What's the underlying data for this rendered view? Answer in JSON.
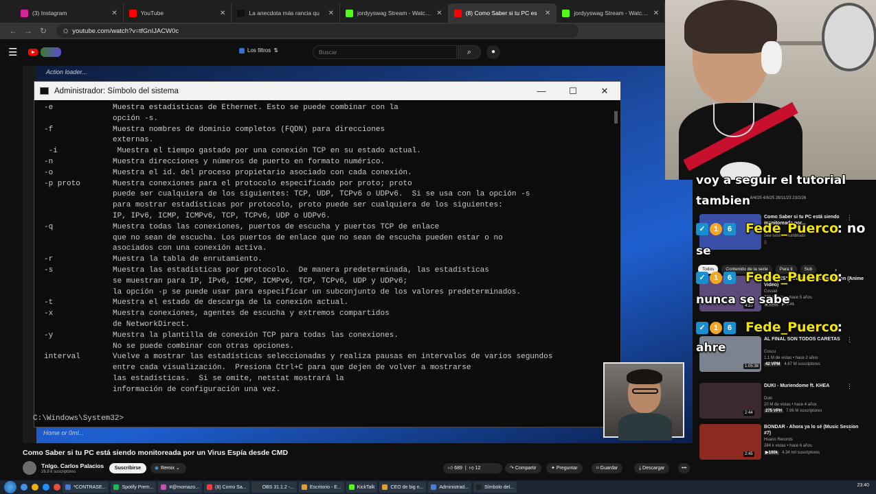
{
  "browser": {
    "tabs": [
      {
        "label": "(3) Instagram",
        "color": "#d6249f"
      },
      {
        "label": "YouTube",
        "color": "#ff0000"
      },
      {
        "label": "La anecdota más rancia qu",
        "color": "#111111"
      },
      {
        "label": "jordyyswag Stream - Watch Liv",
        "color": "#53fc18"
      },
      {
        "label": "(8) Como Saber si tu PC es",
        "color": "#ff0000",
        "active": true
      },
      {
        "label": "jordyyswag Stream - Watch Liv",
        "color": "#53fc18"
      }
    ],
    "url": "youtube.com/watch?v=tfGnIJACW0c"
  },
  "youtube": {
    "filters_label": "Los filtros",
    "search_placeholder": "Buscar"
  },
  "video": {
    "overlay_top": "Action loader...",
    "overlay_bottom": "Home or 0ml...",
    "cmd_title": "Administrador: Símbolo del sistema",
    "cmd_lines": [
      {
        "flag": "-e",
        "desc": "Muestra estadísticas de Ethernet. Esto se puede combinar con la"
      },
      {
        "flag": "",
        "desc": "opción -s."
      },
      {
        "flag": "-f",
        "desc": "Muestra nombres de dominio completos (FQDN) para direcciones"
      },
      {
        "flag": "",
        "desc": "externas."
      },
      {
        "flag": " -i",
        "desc": " Muestra el tiempo gastado por una conexión TCP en su estado actual."
      },
      {
        "flag": "-n",
        "desc": "Muestra direcciones y números de puerto en formato numérico."
      },
      {
        "flag": "-o",
        "desc": "Muestra el id. del proceso propietario asociado con cada conexión."
      },
      {
        "flag": "-p proto",
        "desc": "Muestra conexiones para el protocolo especificado por proto; proto"
      },
      {
        "flag": "",
        "desc": "puede ser cualquiera de los siguientes: TCP, UDP, TCPv6 o UDPv6.  Si se usa con la opción -s"
      },
      {
        "flag": "",
        "desc": "para mostrar estadísticas por protocolo, proto puede ser cualquiera de los siguientes:"
      },
      {
        "flag": "",
        "desc": "IP, IPv6, ICMP, ICMPv6, TCP, TCPv6, UDP o UDPv6."
      },
      {
        "flag": "-q",
        "desc": "Muestra todas las conexiones, puertos de escucha y puertos TCP de enlace"
      },
      {
        "flag": "",
        "desc": "que no sean de escucha. Los puertos de enlace que no sean de escucha pueden estar o no"
      },
      {
        "flag": "",
        "desc": "asociados con una conexión activa."
      },
      {
        "flag": "-r",
        "desc": "Muestra la tabla de enrutamiento."
      },
      {
        "flag": "-s",
        "desc": "Muestra las estadísticas por protocolo.  De manera predeterminada, las estadísticas"
      },
      {
        "flag": "",
        "desc": "se muestran para IP, IPv6, ICMP, ICMPv6, TCP, TCPv6, UDP y UDPv6;"
      },
      {
        "flag": "",
        "desc": "la opción -p se puede usar para especificar un subconjunto de los valores predeterminados."
      },
      {
        "flag": "-t",
        "desc": "Muestra el estado de descarga de la conexión actual."
      },
      {
        "flag": "-x",
        "desc": "Muestra conexiones, agentes de escucha y extremos compartidos"
      },
      {
        "flag": "",
        "desc": "de NetworkDirect."
      },
      {
        "flag": "-y",
        "desc": "Muestra la plantilla de conexión TCP para todas las conexiones."
      },
      {
        "flag": "",
        "desc": "No se puede combinar con otras opciones."
      },
      {
        "flag": "interval",
        "desc": "Vuelve a mostrar las estadísticas seleccionadas y realiza pausas en intervalos de varios segundos"
      },
      {
        "flag": "",
        "desc": "entre cada visualización.  Presiona Ctrl+C para que dejen de volver a mostrarse"
      },
      {
        "flag": "",
        "desc": "las estadísticas.  Si se omite, netstat mostrará la"
      },
      {
        "flag": "",
        "desc": "información de configuración una vez."
      }
    ],
    "cmd_prompt": "C:\\Windows\\System32>",
    "title": "Como Saber si tu PC está siendo monitoreada por un Virus Espía desde CMD",
    "channel": "Tnlgo. Carlos Palacios",
    "subscribers": "26.9 k suscriptores",
    "subscribe_label": "Suscribirse",
    "remix_label": "Remix",
    "likes": "689",
    "dislikes": "12",
    "share_label": "Compartir",
    "ask_label": "Preguntar",
    "save_label": "Guardar",
    "download_label": "Descargar",
    "more_label": "•••"
  },
  "chat": [
    {
      "user": "",
      "text": "voy a seguir el tutorial"
    },
    {
      "user": "",
      "text": "tambien"
    },
    {
      "user": "Fede_Puerco",
      "text": ": no"
    },
    {
      "user": "",
      "text": "se"
    },
    {
      "user": "Fede_Puerco",
      "text": ":"
    },
    {
      "user": "",
      "text": "nunca se sabe"
    },
    {
      "user": "Fede_Puerco",
      "text": ":"
    },
    {
      "user": "",
      "text": "ahre"
    }
  ],
  "sidebar": {
    "dates": "8/4/25    4/8/25    28/11/23    23/2/26",
    "chips": [
      "Todos",
      "Contenido de la serie",
      "Para ti",
      "Sub"
    ],
    "recs": [
      {
        "title": "Como Saber si tu PC está siendo monitoreada por...",
        "channel": "",
        "views": "See similar thumbnails",
        "badge": "",
        "extra": "",
        "duration": "",
        "thumb": "#3a4fa8"
      },
      {
        "title": "\"AVECES\" - Cvssiel Feat. Vanlauren (Anime Video)",
        "channel": "Cvssiel",
        "views": "777 k vistas • hace 5 años",
        "badge": "2 VPM",
        "extra": "▶ 9.46",
        "duration": "4:10",
        "thumb": "#5b4a7a"
      },
      {
        "title": "AL FINAL SON TODOS CARETAS",
        "channel": "Coscu",
        "views": "1.1 M de vistas • hace 2 años",
        "badge": "42 VPM",
        "extra": "4.67 M suscriptores",
        "duration": "1:05:38",
        "thumb": "#7c8390"
      },
      {
        "title": "DUKI - Muriendome ft. KHEA",
        "channel": "Duki",
        "views": "20 M de vistas • hace 4 años",
        "badge": "275 VPH",
        "extra": "7.96 M suscriptores",
        "duration": "2:44",
        "thumb": "#3a2a30"
      },
      {
        "title": "BONDAR - Ahora ya lo sé (Music Session #7)",
        "channel": "Huano Records",
        "views": "284 k vistas • hace 6 años",
        "badge": "▶100k",
        "extra": "4.34 mil suscriptores",
        "duration": "2:45",
        "thumb": "#8c2a1f"
      }
    ]
  },
  "taskbar": {
    "tasks": [
      {
        "label": "*CONTRASE...",
        "color": "#4a7bd1"
      },
      {
        "label": "Spotify Prem...",
        "color": "#1db954"
      },
      {
        "label": "#@momazo...",
        "color": "#c94cb0"
      },
      {
        "label": "(8) Como Sa...",
        "color": "#ff3b3b"
      },
      {
        "label": "OBS 31.1.2 -...",
        "color": "#333333"
      },
      {
        "label": "Escritorio - E...",
        "color": "#e0a030"
      },
      {
        "label": "KickTalk",
        "color": "#53fc18"
      },
      {
        "label": "CEO de big n...",
        "color": "#e0a030"
      },
      {
        "label": "Administrad...",
        "color": "#4a7bd1"
      },
      {
        "label": "Símbolo del...",
        "color": "#222222"
      }
    ],
    "clock": "23:40"
  }
}
